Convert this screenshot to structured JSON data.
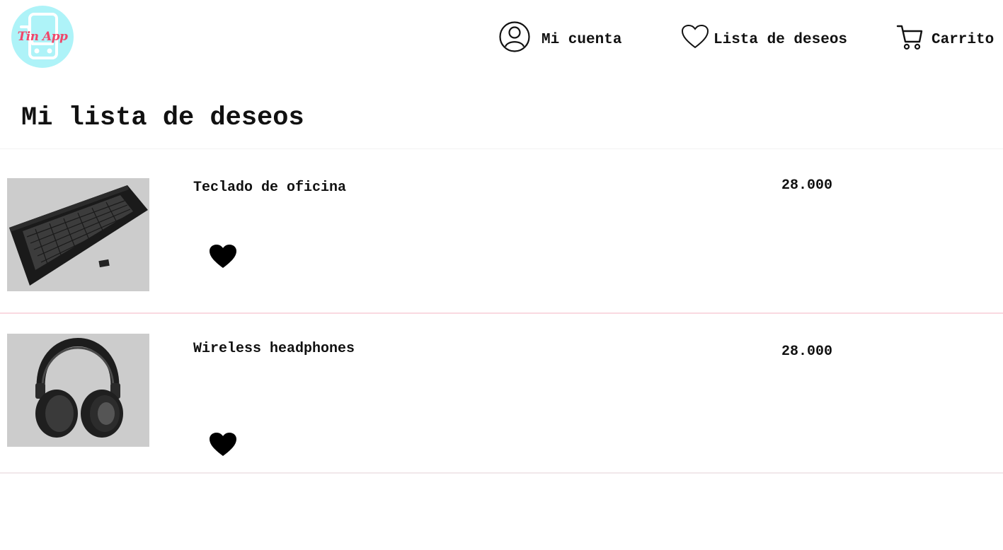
{
  "brand": {
    "logo_text": "Tin App",
    "logo_bg": "#aef3f8",
    "logo_accent": "#f0466a"
  },
  "nav": {
    "account": {
      "label": "Mi cuenta",
      "icon": "user-circle-icon"
    },
    "wishlist": {
      "label": "Lista de deseos",
      "icon": "heart-outline-icon"
    },
    "cart": {
      "label": "Carrito",
      "icon": "cart-icon"
    }
  },
  "page": {
    "title": "Mi lista de deseos"
  },
  "wishlist": {
    "items": [
      {
        "name": "Teclado de oficina",
        "price": "28.000",
        "image": "keyboard-image",
        "favorite_icon": "heart-filled-icon"
      },
      {
        "name": "Wireless headphones",
        "price": "28.000",
        "image": "headphones-image",
        "favorite_icon": "heart-filled-icon"
      }
    ]
  },
  "colors": {
    "divider_pink": "#fad9e1",
    "thumb_bg": "#cccccc",
    "text": "#111111"
  }
}
